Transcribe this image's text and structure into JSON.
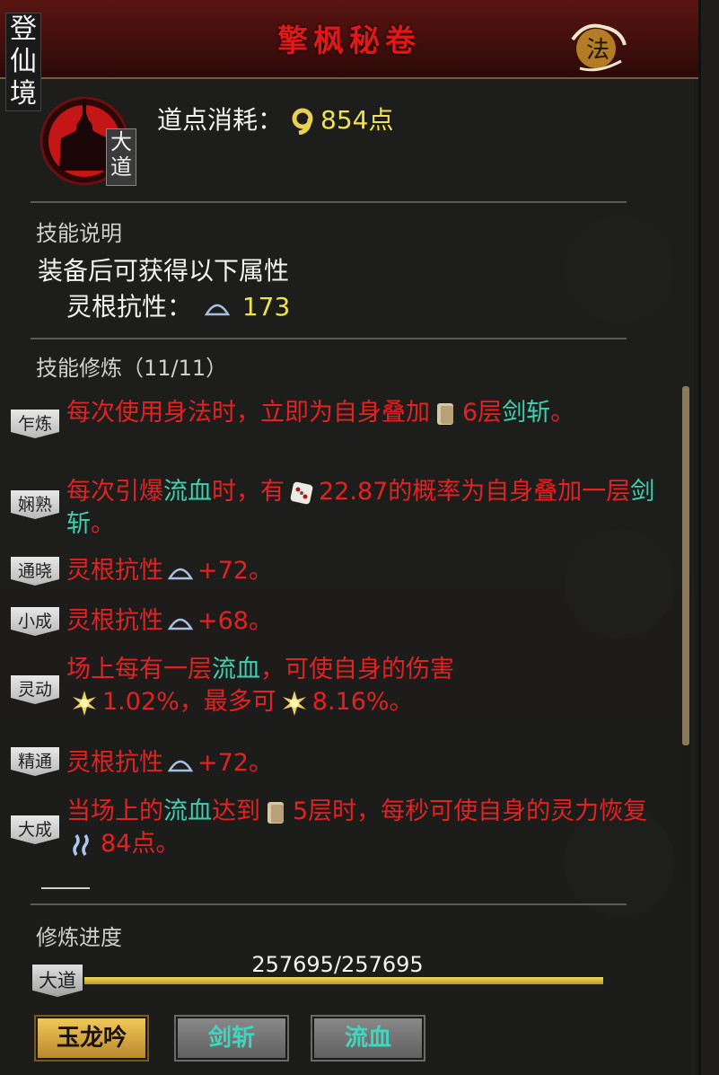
{
  "realm": "登仙境",
  "title": "擎枫秘卷",
  "seal_glyph": "法",
  "skill_tag": "大道",
  "cost": {
    "label": "道点消耗：",
    "value": "854点"
  },
  "description": {
    "header": "技能说明",
    "text": "装备后可获得以下属性",
    "attr_label": "灵根抗性：",
    "attr_value": "173"
  },
  "training": {
    "header": "技能修炼（11/11）",
    "entries": [
      {
        "stage": "乍炼",
        "parts": [
          "每次使用身法时，立即为自身叠加",
          "6层",
          "剑斩",
          "。"
        ]
      },
      {
        "stage": "娴熟",
        "parts": [
          "每次引爆",
          "流血",
          "时，有",
          "22.87的概率为自身叠加一层",
          "剑斩",
          "。"
        ]
      },
      {
        "stage": "通晓",
        "parts": [
          "灵根抗性",
          "+72。"
        ]
      },
      {
        "stage": "小成",
        "parts": [
          "灵根抗性",
          "+68。"
        ]
      },
      {
        "stage": "灵动",
        "parts": [
          "场上每有一层",
          "流血",
          "，可使自身的伤害",
          "1.02%，最多可",
          "8.16%。"
        ]
      },
      {
        "stage": "精通",
        "parts": [
          "灵根抗性",
          "+72。"
        ]
      },
      {
        "stage": "大成",
        "parts": [
          "当场上的",
          "流血",
          "达到",
          "5层时，每秒可使自身的灵力恢复",
          "84点。"
        ]
      }
    ]
  },
  "progress": {
    "label": "修炼进度",
    "tag": "大道",
    "text": "257695/257695",
    "fraction": 1.0
  },
  "tabs": [
    {
      "label": "玉龙吟",
      "active": true
    },
    {
      "label": "剑斩",
      "active": false
    },
    {
      "label": "流血",
      "active": false
    }
  ],
  "colors": {
    "title_red": "#e01818",
    "body_red": "#e32222",
    "cyan": "#3fd0b0",
    "yellow": "#f0e44a"
  }
}
